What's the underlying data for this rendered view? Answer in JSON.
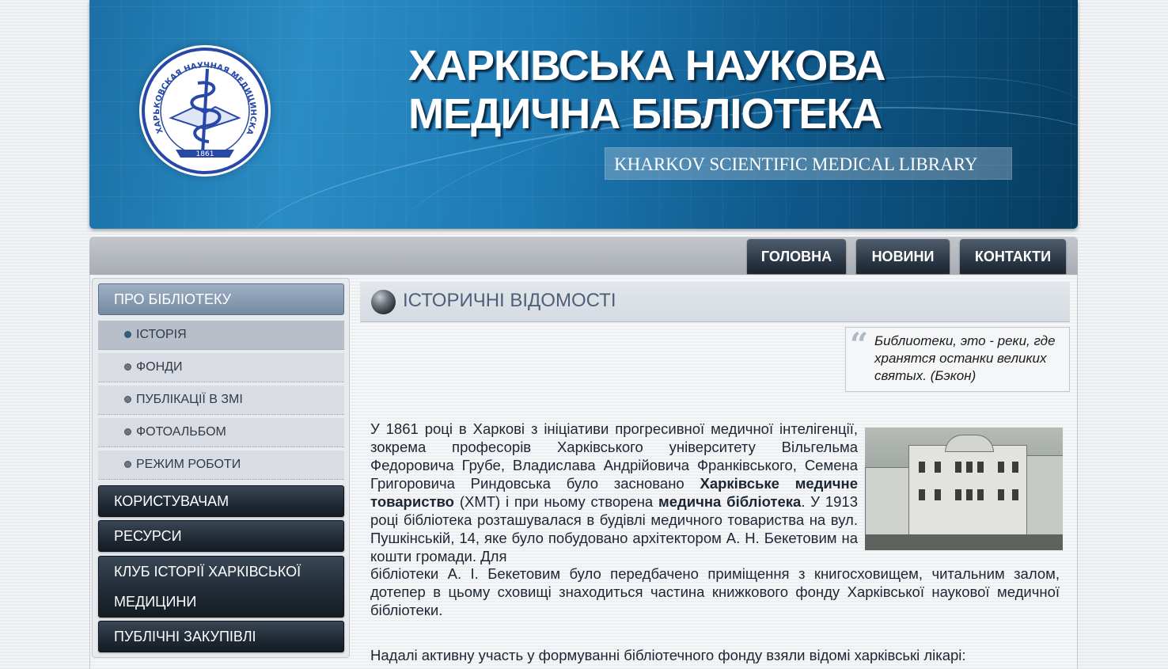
{
  "header": {
    "title_line1": "ХАРКІВСЬКА НАУКОВА",
    "title_line2": "МЕДИЧНА БІБЛІОТЕКА",
    "subtitle": "KHARKOV SCIENTIFIC MEDICAL LIBRARY",
    "seal_top_text": "ХАРЬКОВСКАЯ НАУЧНАЯ МЕДИЦИНСКАЯ БИБЛИОТЕКА",
    "seal_year": "1861"
  },
  "nav": {
    "items": [
      {
        "label": "ГОЛОВНА"
      },
      {
        "label": "НОВИНИ"
      },
      {
        "label": "КОНТАКТИ"
      }
    ]
  },
  "sidebar": {
    "section_label": "ПРО БІБЛІОТЕКУ",
    "sub_items": [
      {
        "label": "ІСТОРІЯ",
        "active": true
      },
      {
        "label": "ФОНДИ"
      },
      {
        "label": "ПУБЛІКАЦІЇ В ЗМІ"
      },
      {
        "label": "ФОТОАЛЬБОМ"
      },
      {
        "label": "РЕЖИМ РОБОТИ"
      }
    ],
    "main_items": [
      {
        "label": "КОРИСТУВАЧАМ"
      },
      {
        "label": "РЕСУРСИ"
      },
      {
        "label": "КЛУБ ІСТОРІЇ ХАРКІВСЬКОЇ МЕДИЦИНИ"
      },
      {
        "label": "ПУБЛІЧНІ ЗАКУПІВЛІ"
      }
    ]
  },
  "content": {
    "title": "ІСТОРИЧНІ ВІДОМОСТІ",
    "quote": "Библиотеки, это - реки, где хранятся останки великих святых. (Бэкон)",
    "para1_a": "У 1861 році в Харкові з ініціативи прогресивної медичної інтелігенції, зокрема професорів Харківського університету Вільгельма Федоровича Грубе, Владислава Андрійовича Франківського, Семена Григоровича Риндовська було засновано ",
    "para1_b": "Харківське медичне товариство",
    "para1_c": " (ХМТ) і при ньому створена ",
    "para1_d": "медична бібліотека",
    "para1_e": ". У 1913 році бібліотека розташувалася в будівлі медичного товариства на вул. Пушкінській, 14, яке було побудовано архітектором А. Н. Бекетовим на кошти громади. Для бібліотеки А. І. Бекетовим було передбачено приміщення з книгосховищем, читальним залом, дотепер в цьому сховищі знаходиться частина книжкового фонду Харківської наукової медичної бібліотеки.",
    "para2": "Надалі активну участь у формуванні бібліотечного фонду взяли відомі харківські лікарі:"
  },
  "colors": {
    "banner_dark": "#073c5f",
    "banner_light": "#2a8cc4",
    "nav_button": "#2c3846",
    "sidebar_active": "#7489a2",
    "title_text": "#4d6078"
  }
}
